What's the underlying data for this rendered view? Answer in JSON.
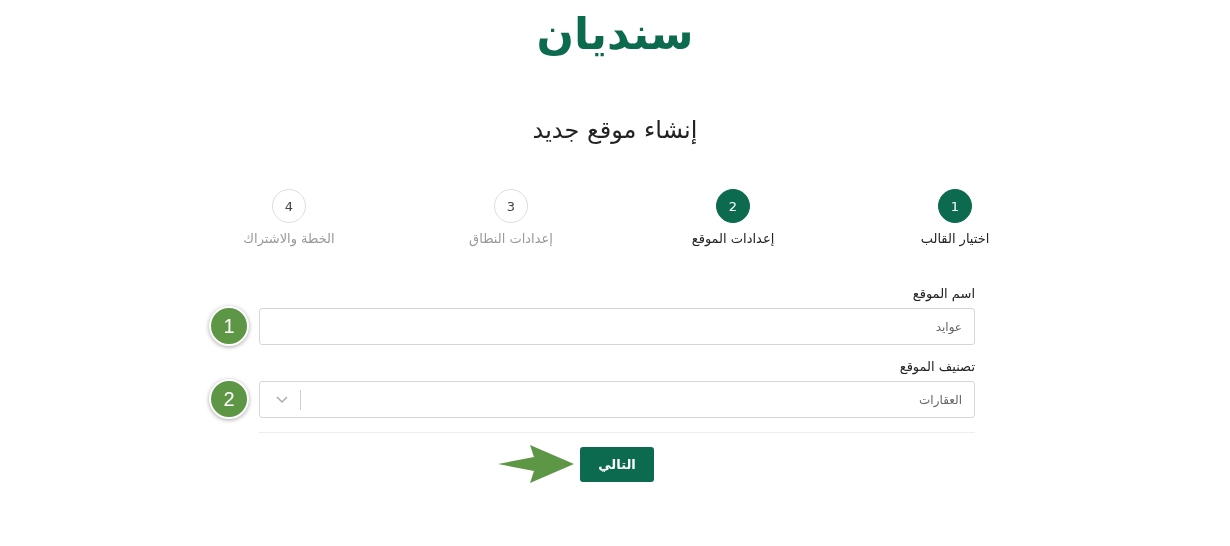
{
  "logo": "سنديان",
  "title": "إنشاء موقع جديد",
  "steps": [
    {
      "number": "1",
      "label": "اختيار القالب",
      "active": true
    },
    {
      "number": "2",
      "label": "إعدادات الموقع",
      "active": true
    },
    {
      "number": "3",
      "label": "إعدادات النطاق",
      "active": false
    },
    {
      "number": "4",
      "label": "الخطة والاشتراك",
      "active": false
    }
  ],
  "fields": [
    {
      "kind": "text",
      "label": "اسم الموقع",
      "value": "عوايد",
      "marker": "1"
    },
    {
      "kind": "select",
      "label": "تصنيف الموقع",
      "value": "العقارات",
      "marker": "2"
    }
  ],
  "next_button": "التالي"
}
